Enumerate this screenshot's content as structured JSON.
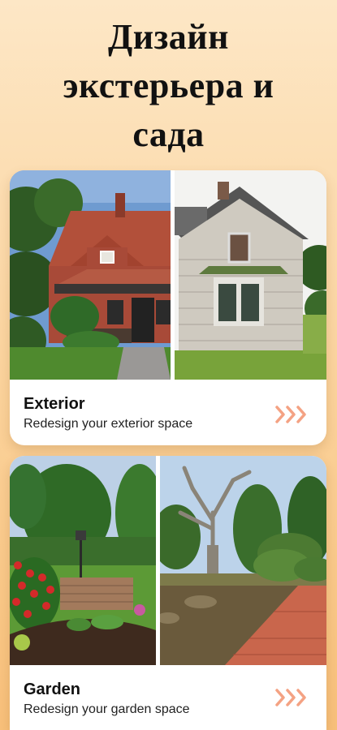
{
  "header": {
    "title_line1": "Дизайн",
    "title_line2": "экстерьера и",
    "title_line3": "сада"
  },
  "cards": [
    {
      "title": "Exterior",
      "subtitle": "Redesign your exterior space"
    },
    {
      "title": "Garden",
      "subtitle": "Redesign your garden space"
    }
  ],
  "colors": {
    "accent": "#f4a283",
    "background_top": "#fde7c6",
    "background_bottom": "#f8c07a"
  },
  "icons": {
    "card_arrow": "triple-chevron-right-icon"
  }
}
